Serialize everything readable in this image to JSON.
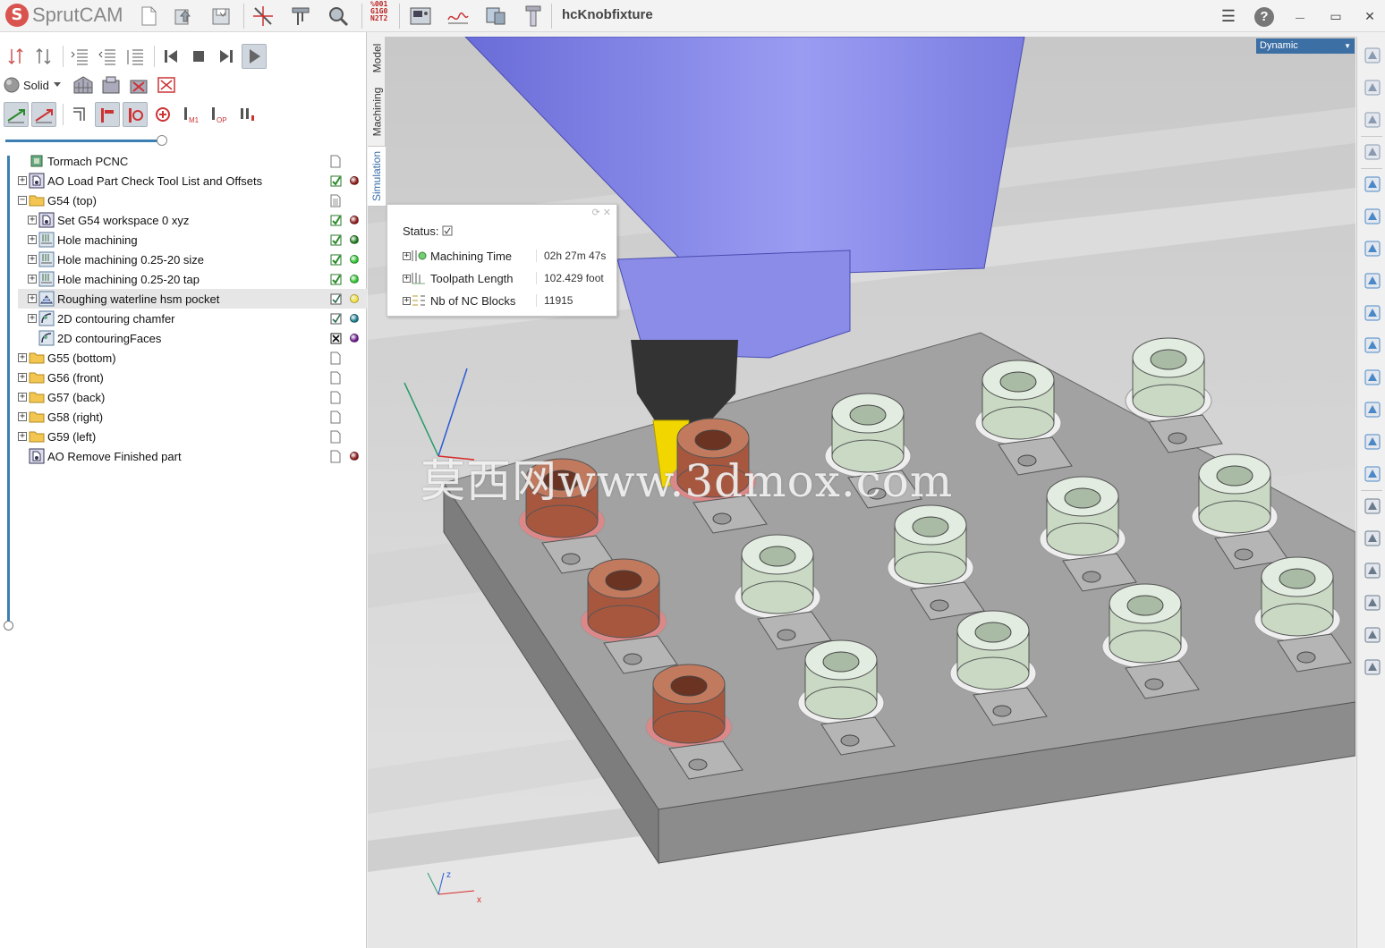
{
  "app": {
    "name": "SprutCAM",
    "logo_letter": "S",
    "document_title": "hcKnobfixture",
    "nc_code_lines": [
      "%001",
      "G1G0",
      "N2T2"
    ]
  },
  "titlebar": {
    "icons": [
      "new-file-icon",
      "open-file-icon",
      "save-file-icon",
      "axis-tool-icon",
      "caliper-icon",
      "inspect-icon",
      "machine-panel-icon",
      "toolpath-chart-icon",
      "setup-icon",
      "tool-icon"
    ],
    "window_controls": {
      "menu": "☰",
      "help": "?",
      "minimize": "—",
      "restore": "▭",
      "close": "✕"
    }
  },
  "left_toolbar": {
    "render_mode_label": "Solid"
  },
  "tree": {
    "items": [
      {
        "label": "Tormach PCNC",
        "level": 0,
        "expander": "",
        "icon": "machine-icon",
        "check": "file",
        "dot": ""
      },
      {
        "label": "AO Load Part Check Tool List and Offsets",
        "level": 0,
        "expander": "+",
        "icon": "auxiliary-op-icon",
        "check": "checked",
        "dot": "#8b1a1a"
      },
      {
        "label": "G54 (top)",
        "level": 0,
        "expander": "−",
        "icon": "folder-icon",
        "check": "file-lines",
        "dot": ""
      },
      {
        "label": "Set G54 workspace 0 xyz",
        "level": 1,
        "expander": "+",
        "icon": "auxiliary-op-icon",
        "check": "checked",
        "dot": "#8b1a1a"
      },
      {
        "label": "Hole machining",
        "level": 1,
        "expander": "+",
        "icon": "hole-machining-icon",
        "check": "checked",
        "dot": "#1e7a1e"
      },
      {
        "label": "Hole machining 0.25-20 size",
        "level": 1,
        "expander": "+",
        "icon": "hole-machining-icon",
        "check": "checked",
        "dot": "#2fbf2f"
      },
      {
        "label": "Hole machining 0.25-20 tap",
        "level": 1,
        "expander": "+",
        "icon": "hole-machining-icon",
        "check": "checked",
        "dot": "#2fbf2f"
      },
      {
        "label": "Roughing waterline hsm pocket",
        "level": 1,
        "expander": "+",
        "icon": "waterline-icon",
        "check": "checked-gray",
        "dot": "#f2e23a",
        "selected": true
      },
      {
        "label": "2D contouring chamfer",
        "level": 1,
        "expander": "+",
        "icon": "contouring-icon",
        "check": "checked-gray",
        "dot": "#1a7a8a"
      },
      {
        "label": "2D contouringFaces",
        "level": 1,
        "expander": "",
        "icon": "contouring-icon",
        "check": "crossed",
        "dot": "#6a1a8a"
      },
      {
        "label": "G55 (bottom)",
        "level": 0,
        "expander": "+",
        "icon": "folder-icon",
        "check": "file",
        "dot": ""
      },
      {
        "label": "G56 (front)",
        "level": 0,
        "expander": "+",
        "icon": "folder-icon",
        "check": "file",
        "dot": ""
      },
      {
        "label": "G57 (back)",
        "level": 0,
        "expander": "+",
        "icon": "folder-icon",
        "check": "file",
        "dot": ""
      },
      {
        "label": "G58 (right)",
        "level": 0,
        "expander": "+",
        "icon": "folder-icon",
        "check": "file",
        "dot": ""
      },
      {
        "label": "G59 (left)",
        "level": 0,
        "expander": "+",
        "icon": "folder-icon",
        "check": "file",
        "dot": ""
      },
      {
        "label": "AO Remove Finished part",
        "level": 0,
        "expander": "",
        "icon": "auxiliary-op-icon",
        "check": "file",
        "dot": "#8b1a1a"
      }
    ]
  },
  "viewport": {
    "tabs": [
      "Model",
      "Machining",
      "Simulation"
    ],
    "active_tab": "Simulation",
    "view_mode": "Dynamic",
    "status": {
      "title": "Status:",
      "rows": [
        {
          "name": "Machining Time",
          "value": "02h 27m 47s"
        },
        {
          "name": "Toolpath Length",
          "value": "102.429 foot"
        },
        {
          "name": "Nb of NC Blocks",
          "value": "11915"
        }
      ]
    },
    "watermark": "莫西网www.3dmox.com",
    "triad": {
      "x": "x",
      "z": "z"
    },
    "colors": {
      "spindle": "#8a8ce8",
      "tool": "#f2d600",
      "machined_part": "#a8573f",
      "unmachined_part": "#c9d9c4",
      "fixture_plate": "#9c9c9c"
    }
  },
  "right_toolbar": {
    "icons": [
      "view-sphere-icon",
      "shaded-icon",
      "view-fit-icon",
      "iso-view-icon",
      "front-view-icon",
      "holder-icon",
      "tool-icon",
      "stock-icon",
      "tool-edit-icon",
      "drill-icon",
      "tap-icon",
      "fixture-icon",
      "rotate-part-icon",
      "layers-icon",
      "filter-point-icon",
      "filter-curve-icon",
      "filter-mesh-icon",
      "filter-solid-icon",
      "filter-surface-icon",
      "filter-all-icon"
    ]
  }
}
